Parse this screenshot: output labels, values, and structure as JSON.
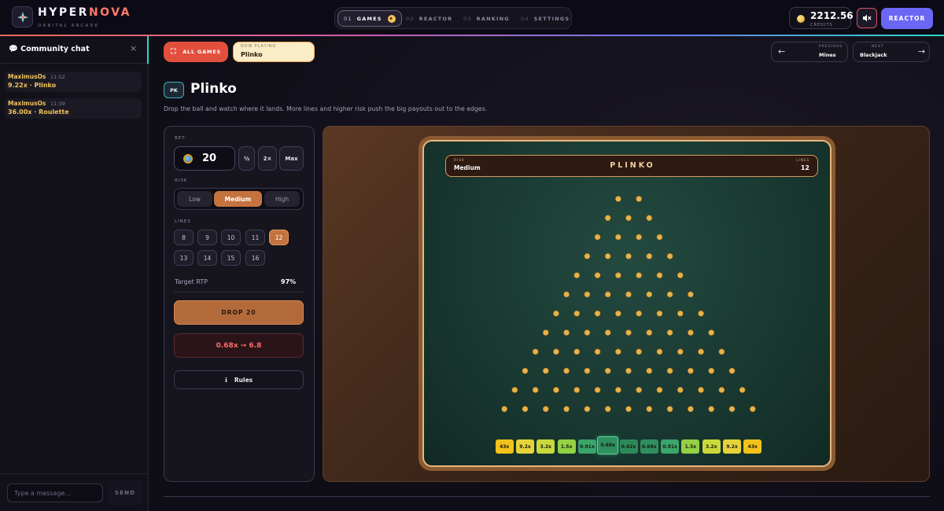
{
  "brand": {
    "name_main": "HYPER",
    "name_accent": "NOVA",
    "subtitle": "ORBITAL ARCADE"
  },
  "nav": {
    "tabs": [
      {
        "num": "01",
        "label": "GAMES",
        "active": true
      },
      {
        "num": "02",
        "label": "REACTOR"
      },
      {
        "num": "03",
        "label": "RANKING"
      },
      {
        "num": "04",
        "label": "SETTINGS"
      }
    ]
  },
  "wallet": {
    "credits": "2212.56",
    "credits_label": "CREDITS"
  },
  "reactor_button": "REACTOR",
  "chat": {
    "title": "Community chat",
    "close": "×",
    "messages": [
      {
        "user": "MaximusOs",
        "time": "11:52",
        "text": "9.22x · Plinko"
      },
      {
        "user": "MaximusOs",
        "time": "11:39",
        "text": "36.00x · Roulette"
      }
    ],
    "input_placeholder": "Type a message…",
    "send_label": "SEND"
  },
  "header": {
    "all_games": "ALL GAMES",
    "now_playing_label": "NOW PLAYING",
    "now_playing": "Plinko",
    "previous_label": "PREVIOUS",
    "previous": "Mines",
    "next_label": "NEXT",
    "next": "Blackjack"
  },
  "game": {
    "badge": "PK",
    "title": "Plinko",
    "description": "Drop the ball and watch where it lands. More lines and higher risk push the big payouts out to the edges."
  },
  "controls": {
    "bet_label": "BET",
    "bet_value": "20",
    "bet_buttons": [
      "½",
      "2×",
      "Max"
    ],
    "risk_label": "RISK",
    "risk_options": [
      "Low",
      "Medium",
      "High"
    ],
    "risk_selected": "Medium",
    "lines_label": "LINES",
    "lines_options": [
      "8",
      "9",
      "10",
      "11",
      "12",
      "13",
      "14",
      "15",
      "16"
    ],
    "lines_selected": "12",
    "rtp_label": "Target RTP",
    "rtp_value": "97%",
    "drop_label": "DROP 20",
    "payout": "0.68x  →  6.8",
    "rules_label": "Rules"
  },
  "board": {
    "risk_label": "RISK",
    "risk_value": "Medium",
    "title": "PLINKO",
    "lines_label": "LINES",
    "lines_value": "12",
    "multipliers": [
      "43x",
      "9.2x",
      "3.2x",
      "1.5x",
      "0.91x",
      "0.68x",
      "0.62x",
      "0.68x",
      "0.91x",
      "1.5x",
      "3.2x",
      "9.2x",
      "43x"
    ],
    "highlighted_slot": 5,
    "slot_colors": [
      "#f2c21a",
      "#e6d33a",
      "#c9d93b",
      "#93d145",
      "#3aa66a",
      "#2f8f5f",
      "#2c8a5a",
      "#2f8f5f",
      "#3aa66a",
      "#93d145",
      "#c9d93b",
      "#e6d33a",
      "#f2c21a"
    ],
    "peg_color": "#e8b24a"
  }
}
